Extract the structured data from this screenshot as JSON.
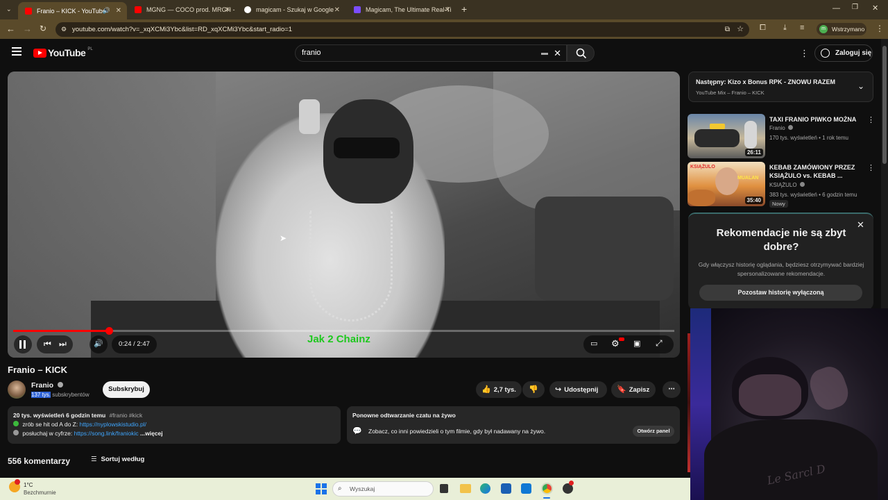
{
  "browser": {
    "tabs": [
      {
        "title": "Franio – KICK - YouTube",
        "active": true,
        "fav_color": "#ff0000"
      },
      {
        "title": "MGNG — COCO prod. MRGH -",
        "active": false,
        "fav_color": "#ff0000"
      },
      {
        "title": "magicam - Szukaj w Google",
        "active": false,
        "fav_color": "#ffffff"
      },
      {
        "title": "Magicam, The Ultimate Real-Ti",
        "active": false,
        "fav_color": "#7b4dff"
      }
    ],
    "url": "youtube.com/watch?v=_xqXCMi3Ybc&list=RD_xqXCMi3Ybc&start_radio=1",
    "profile_label": "Wstrzymano",
    "profile_initial": "m"
  },
  "youtube": {
    "logo": "YouTube",
    "region": "PL",
    "search_value": "franio",
    "login_label": "Zaloguj się"
  },
  "player": {
    "caption": "Jak 2 Chainz",
    "time": "0:24 / 2:47",
    "progress": 0.145
  },
  "video": {
    "title": "Franio – KICK",
    "channel": "Franio",
    "subs_highlight": "137 tys.",
    "subs_rest": "subskrybentów",
    "subscribe_label": "Subskrybuj",
    "likes": "2,7 tys.",
    "share_label": "Udostępnij",
    "save_label": "Zapisz",
    "desc_stats": "20 tys. wyświetleń  6 godzin temu",
    "desc_tags": "#franio #kick",
    "desc_line1": "zrób se hit od A do Z:",
    "desc_link1": "https://nyplowskistudio.pl/",
    "desc_line2": "posłuchaj w cyfrze:",
    "desc_link2": "https://song.link/franiokic",
    "more_label": "...więcej",
    "chat_title": "Ponowne odtwarzanie czatu na żywo",
    "chat_text": "Zobacz, co inni powiedzieli o tym filmie, gdy był nadawany na żywo.",
    "chat_btn": "Otwórz panel",
    "comments": "556 komentarzy",
    "sort_label": "Sortuj według"
  },
  "sidebar": {
    "next_label": "Następny: Kizo x Bonus RPK - ZNOWU RAZEM",
    "mix_label": "YouTube Mix – Franio – KICK",
    "cards": [
      {
        "title": "TAXI FRANIO PIWKO MOŻNA",
        "channel": "Franio",
        "meta": "170 tys. wyświetleń • 1 rok temu",
        "duration": "26:11"
      },
      {
        "title": "KEBAB ZAMÓWIONY PRZEZ KSIĄŻULO vs. KEBAB ...",
        "channel": "KSIĄŻULO",
        "meta": "383 tys. wyświetleń • 6 godzin temu",
        "duration": "35:40",
        "badge": "Nowy",
        "thumb_text1": "KSIĄŻULO",
        "thumb_text2": "MUALAN"
      }
    ],
    "reco_title": "Rekomendacje nie są zbyt dobre?",
    "reco_text": "Gdy włączysz historię oglądania, będziesz otrzymywać bardziej spersonalizowane rekomendacje.",
    "reco_btn": "Pozostaw historię wyłączoną"
  },
  "taskbar": {
    "temp": "1°C",
    "weather": "Bezchmurnie",
    "search_placeholder": "Wyszukaj"
  },
  "webcam": {
    "shirt_text": "Le Sarcl D"
  }
}
